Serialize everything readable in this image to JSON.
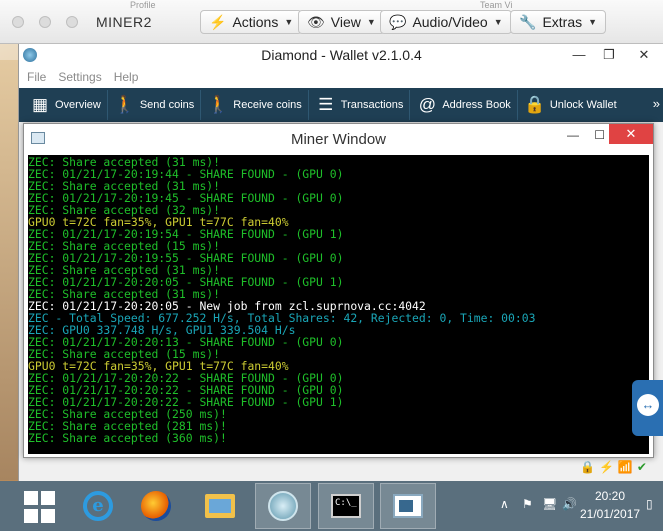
{
  "vm": {
    "title": "MINER2",
    "host_hint_left": "Profile",
    "host_hint_right": "Team Vi",
    "buttons": [
      {
        "label": "Actions",
        "icon": "lightning-icon"
      },
      {
        "label": "View",
        "icon": "eye-icon"
      },
      {
        "label": "Audio/Video",
        "icon": "chat-bubbles-icon"
      },
      {
        "label": "Extras",
        "icon": "wrench-icon"
      }
    ]
  },
  "wallet": {
    "title": "Diamond - Wallet v2.1.0.4",
    "menu": [
      "File",
      "Settings",
      "Help"
    ],
    "toolbar": [
      {
        "label": "Overview",
        "icon": "grid-icon"
      },
      {
        "label": "Send coins",
        "icon": "send-person-icon"
      },
      {
        "label": "Receive coins",
        "icon": "receive-person-icon"
      },
      {
        "label": "Transactions",
        "icon": "list-icon"
      },
      {
        "label": "Address Book",
        "icon": "address-book-icon"
      },
      {
        "label": "Unlock Wallet",
        "icon": "lock-icon"
      }
    ]
  },
  "miner": {
    "title": "Miner Window",
    "lines": [
      {
        "text": "ZEC: Share accepted (31 ms)!",
        "color": "green"
      },
      {
        "text": "ZEC: 01/21/17-20:19:44 - SHARE FOUND - (GPU 0)",
        "color": "green"
      },
      {
        "text": "ZEC: Share accepted (31 ms)!",
        "color": "green"
      },
      {
        "text": "ZEC: 01/21/17-20:19:45 - SHARE FOUND - (GPU 0)",
        "color": "green"
      },
      {
        "text": "ZEC: Share accepted (32 ms)!",
        "color": "green"
      },
      {
        "text": "GPU0 t=72C fan=35%, GPU1 t=77C fan=40%",
        "color": "yellow"
      },
      {
        "text": "ZEC: 01/21/17-20:19:54 - SHARE FOUND - (GPU 1)",
        "color": "green"
      },
      {
        "text": "ZEC: Share accepted (15 ms)!",
        "color": "green"
      },
      {
        "text": "ZEC: 01/21/17-20:19:55 - SHARE FOUND - (GPU 0)",
        "color": "green"
      },
      {
        "text": "ZEC: Share accepted (31 ms)!",
        "color": "green"
      },
      {
        "text": "ZEC: 01/21/17-20:20:05 - SHARE FOUND - (GPU 1)",
        "color": "green"
      },
      {
        "text": "ZEC: Share accepted (31 ms)!",
        "color": "green"
      },
      {
        "text": "ZEC: 01/21/17-20:20:05 - New job from zcl.suprnova.cc:4042",
        "color": "white"
      },
      {
        "text": "ZEC - Total Speed: 677.252 H/s, Total Shares: 42, Rejected: 0, Time: 00:03",
        "color": "cyan"
      },
      {
        "text": "ZEC: GPU0 337.748 H/s, GPU1 339.504 H/s",
        "color": "cyan"
      },
      {
        "text": "ZEC: 01/21/17-20:20:13 - SHARE FOUND - (GPU 0)",
        "color": "green"
      },
      {
        "text": "ZEC: Share accepted (15 ms)!",
        "color": "green"
      },
      {
        "text": "GPU0 t=72C fan=35%, GPU1 t=77C fan=40%",
        "color": "yellow"
      },
      {
        "text": "ZEC: 01/21/17-20:20:22 - SHARE FOUND - (GPU 0)",
        "color": "green"
      },
      {
        "text": "ZEC: 01/21/17-20:20:22 - SHARE FOUND - (GPU 0)",
        "color": "green"
      },
      {
        "text": "ZEC: 01/21/17-20:20:22 - SHARE FOUND - (GPU 1)",
        "color": "green"
      },
      {
        "text": "ZEC: Share accepted (250 ms)!",
        "color": "green"
      },
      {
        "text": "ZEC: Share accepted (281 ms)!",
        "color": "green"
      },
      {
        "text": "ZEC: Share accepted (360 ms)!",
        "color": "green"
      }
    ]
  },
  "taskbar": {
    "time": "20:20",
    "date": "21/01/2017",
    "apps": [
      "internet-explorer-icon",
      "firefox-icon",
      "file-explorer-icon",
      "diamond-wallet-icon",
      "command-prompt-icon",
      "miner-window-icon"
    ]
  }
}
